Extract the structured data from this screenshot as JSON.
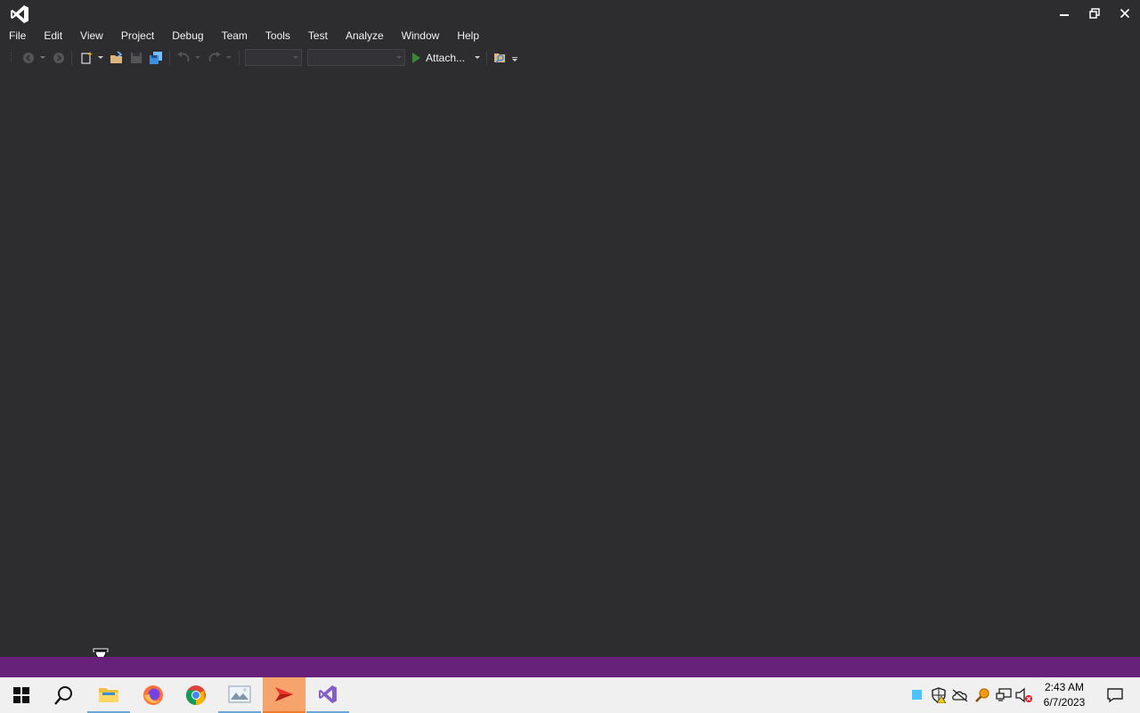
{
  "window": {
    "app_icon": "visual-studio-icon",
    "controls": [
      "minimize-icon",
      "restore-icon",
      "close-icon"
    ]
  },
  "menu": [
    "File",
    "Edit",
    "View",
    "Project",
    "Debug",
    "Team",
    "Tools",
    "Test",
    "Analyze",
    "Window",
    "Help"
  ],
  "toolbar": {
    "attach_label": "Attach...",
    "icons": [
      "back-icon",
      "forward-icon",
      "new-project-icon",
      "open-file-icon",
      "save-icon",
      "save-all-icon",
      "undo-icon",
      "redo-icon",
      "play-icon",
      "find-in-files-icon"
    ],
    "config_combo_value": "",
    "platform_combo_value": ""
  },
  "statusbar": {
    "text": ""
  },
  "taskbar": {
    "apps": [
      {
        "name": "start-icon",
        "state": "normal"
      },
      {
        "name": "search-icon",
        "state": "normal"
      },
      {
        "name": "file-explorer-icon",
        "state": "running"
      },
      {
        "name": "firefox-icon",
        "state": "normal"
      },
      {
        "name": "chrome-icon",
        "state": "normal"
      },
      {
        "name": "photos-icon",
        "state": "running"
      },
      {
        "name": "red-arrow-app-icon",
        "state": "active"
      },
      {
        "name": "visual-studio-icon",
        "state": "running"
      }
    ],
    "tray_icons": [
      "sticky-note-icon",
      "shield-warning-icon",
      "cloud-offline-icon",
      "search-tool-icon",
      "network-icon",
      "volume-muted-icon"
    ],
    "time": "2:43 AM",
    "date": "6/7/2023",
    "notification_icon": "action-center-icon"
  },
  "colors": {
    "background": "#2d2d30",
    "statusbar": "#68217a",
    "taskbar": "#f0f0f0",
    "vs_purple": "#865fc5",
    "play_green": "#388a34"
  }
}
